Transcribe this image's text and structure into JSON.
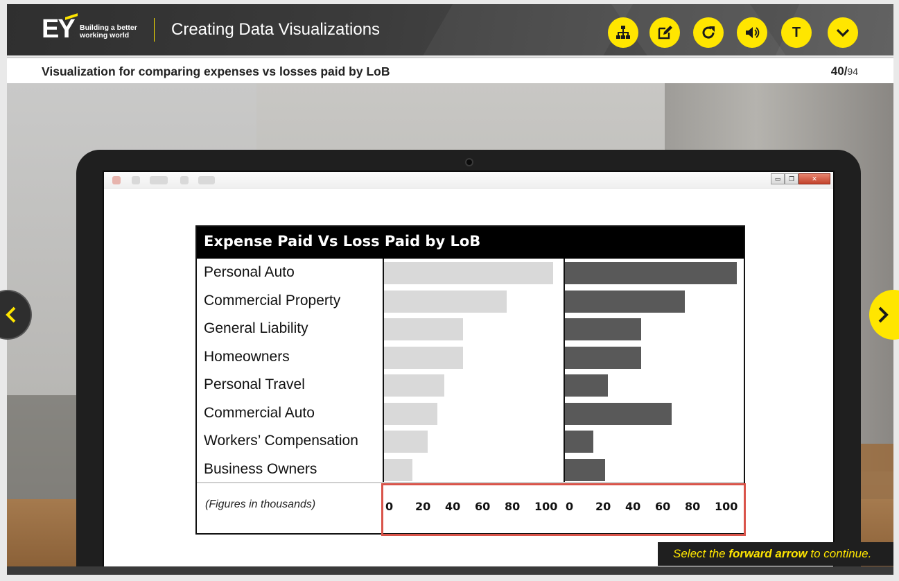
{
  "header": {
    "logo_text": "EY",
    "logo_tagline_1": "Building a better",
    "logo_tagline_2": "working world",
    "course_title": "Creating Data Visualizations",
    "controls": [
      {
        "name": "menu-button",
        "icon": "sitemap-icon"
      },
      {
        "name": "notes-button",
        "icon": "edit-icon"
      },
      {
        "name": "replay-button",
        "icon": "refresh-icon"
      },
      {
        "name": "audio-button",
        "icon": "speaker-icon"
      },
      {
        "name": "transcript-button",
        "icon": "t-letter-icon",
        "label": "T"
      },
      {
        "name": "more-button",
        "icon": "chevron-down-icon"
      }
    ],
    "accent_color": "#ffe600"
  },
  "slide": {
    "title": "Visualization for comparing expenses vs losses paid by LoB",
    "page_current": "40/",
    "page_total": "94"
  },
  "chart_data": {
    "type": "bar",
    "title": "Expense Paid Vs Loss Paid by LoB",
    "categories": [
      "Personal Auto",
      "Commercial Property",
      "General Liability",
      "Homeowners",
      "Personal Travel",
      "Commercial Auto",
      "Workers’ Compensation",
      "Business Owners"
    ],
    "series": [
      {
        "values": [
          101,
          73,
          47,
          47,
          36,
          32,
          26,
          17
        ],
        "color": "#d9d9d9"
      },
      {
        "values": [
          104,
          72,
          46,
          46,
          26,
          64,
          17,
          24
        ],
        "color": "#595959"
      }
    ],
    "footnote": "(Figures in thousands)",
    "ticks": [
      "0",
      "20",
      "40",
      "60",
      "80",
      "100"
    ],
    "xlim": [
      0,
      100
    ],
    "highlight_color": "#d9544a"
  },
  "continue_prompt": {
    "before": "Select the ",
    "bold": "forward arrow",
    "after": " to continue."
  }
}
